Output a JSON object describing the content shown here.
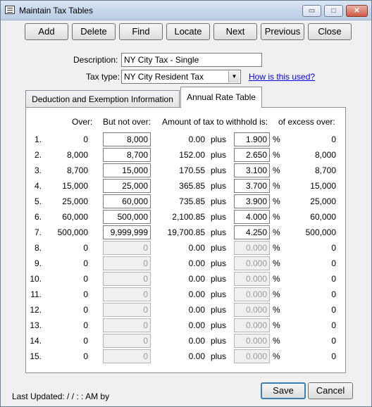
{
  "window": {
    "title": "Maintain Tax Tables",
    "controls": {
      "minimize": "▭",
      "maximize": "□",
      "close": "✕"
    }
  },
  "toolbar": {
    "add": "Add",
    "delete": "Delete",
    "find": "Find",
    "locate": "Locate",
    "next": "Next",
    "previous": "Previous",
    "close": "Close"
  },
  "form": {
    "description_label": "Description:",
    "description_value": "NY City Tax - Single",
    "taxtype_label": "Tax type:",
    "taxtype_value": "NY City Resident Tax",
    "help_link": "How is this used?"
  },
  "tabs": {
    "deduction": "Deduction and Exemption Information",
    "annual": "Annual Rate Table"
  },
  "table": {
    "headers": {
      "over": "Over:",
      "but_not_over": "But not over:",
      "amount": "Amount of tax to withhold is:",
      "excess": "of excess over:"
    },
    "rows": [
      {
        "num": "1.",
        "over": "0",
        "not_over": "8,000",
        "amount": "0.00",
        "plus": "plus",
        "rate": "1.900",
        "pct": "%",
        "excess": "0",
        "enabled": true
      },
      {
        "num": "2.",
        "over": "8,000",
        "not_over": "8,700",
        "amount": "152.00",
        "plus": "plus",
        "rate": "2.650",
        "pct": "%",
        "excess": "8,000",
        "enabled": true
      },
      {
        "num": "3.",
        "over": "8,700",
        "not_over": "15,000",
        "amount": "170.55",
        "plus": "plus",
        "rate": "3.100",
        "pct": "%",
        "excess": "8,700",
        "enabled": true
      },
      {
        "num": "4.",
        "over": "15,000",
        "not_over": "25,000",
        "amount": "365.85",
        "plus": "plus",
        "rate": "3.700",
        "pct": "%",
        "excess": "15,000",
        "enabled": true
      },
      {
        "num": "5.",
        "over": "25,000",
        "not_over": "60,000",
        "amount": "735.85",
        "plus": "plus",
        "rate": "3.900",
        "pct": "%",
        "excess": "25,000",
        "enabled": true
      },
      {
        "num": "6.",
        "over": "60,000",
        "not_over": "500,000",
        "amount": "2,100.85",
        "plus": "plus",
        "rate": "4.000",
        "pct": "%",
        "excess": "60,000",
        "enabled": true
      },
      {
        "num": "7.",
        "over": "500,000",
        "not_over": "9,999,999",
        "amount": "19,700.85",
        "plus": "plus",
        "rate": "4.250",
        "pct": "%",
        "excess": "500,000",
        "enabled": true
      },
      {
        "num": "8.",
        "over": "0",
        "not_over": "0",
        "amount": "0.00",
        "plus": "plus",
        "rate": "0.000",
        "pct": "%",
        "excess": "0",
        "enabled": false
      },
      {
        "num": "9.",
        "over": "0",
        "not_over": "0",
        "amount": "0.00",
        "plus": "plus",
        "rate": "0.000",
        "pct": "%",
        "excess": "0",
        "enabled": false
      },
      {
        "num": "10.",
        "over": "0",
        "not_over": "0",
        "amount": "0.00",
        "plus": "plus",
        "rate": "0.000",
        "pct": "%",
        "excess": "0",
        "enabled": false
      },
      {
        "num": "11.",
        "over": "0",
        "not_over": "0",
        "amount": "0.00",
        "plus": "plus",
        "rate": "0.000",
        "pct": "%",
        "excess": "0",
        "enabled": false
      },
      {
        "num": "12.",
        "over": "0",
        "not_over": "0",
        "amount": "0.00",
        "plus": "plus",
        "rate": "0.000",
        "pct": "%",
        "excess": "0",
        "enabled": false
      },
      {
        "num": "13.",
        "over": "0",
        "not_over": "0",
        "amount": "0.00",
        "plus": "plus",
        "rate": "0.000",
        "pct": "%",
        "excess": "0",
        "enabled": false
      },
      {
        "num": "14.",
        "over": "0",
        "not_over": "0",
        "amount": "0.00",
        "plus": "plus",
        "rate": "0.000",
        "pct": "%",
        "excess": "0",
        "enabled": false
      },
      {
        "num": "15.",
        "over": "0",
        "not_over": "0",
        "amount": "0.00",
        "plus": "plus",
        "rate": "0.000",
        "pct": "%",
        "excess": "0",
        "enabled": false
      }
    ]
  },
  "footer": {
    "last_updated": "Last Updated:  / /     : :  AM by",
    "save": "Save",
    "cancel": "Cancel"
  }
}
